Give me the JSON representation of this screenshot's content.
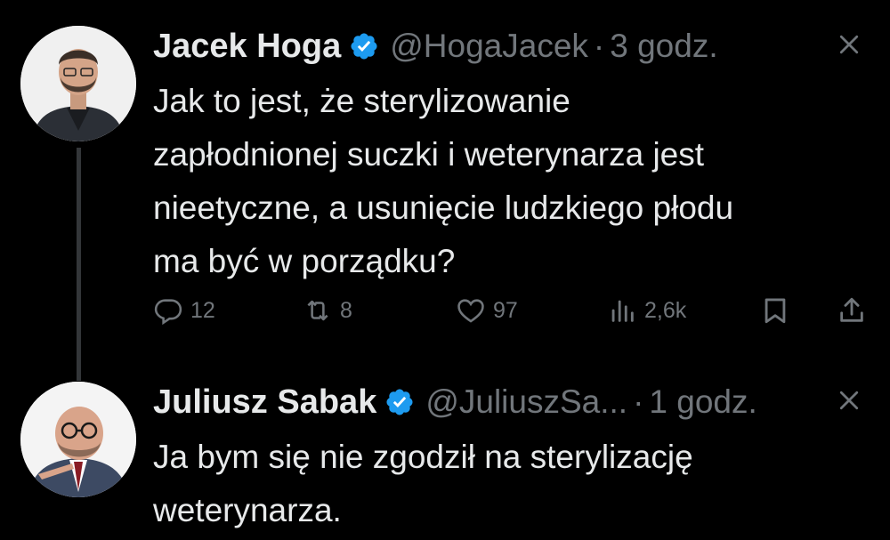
{
  "colors": {
    "background": "#000000",
    "text": "#e7e9ea",
    "secondary": "#71767b",
    "verified": "#1d9bf0",
    "thread_line": "#333639"
  },
  "tweets": [
    {
      "name": "Jacek Hoga",
      "handle": "@HogaJacek",
      "separator": "·",
      "time": "3 godz.",
      "text_lines": [
        "Jak to jest, że sterylizowanie",
        "zapłodnionej suczki i weterynarza jest",
        "nieetyczne, a usunięcie ludzkiego płodu",
        "ma być w porządku?"
      ],
      "actions": {
        "replies": "12",
        "retweets": "8",
        "likes": "97",
        "views": "2,6k"
      },
      "icons": [
        "verified-badge-icon",
        "close-icon",
        "reply-icon",
        "retweet-icon",
        "like-icon",
        "views-icon",
        "bookmark-icon",
        "share-icon"
      ]
    },
    {
      "name": "Juliusz Sabak",
      "handle": "@JuliuszSa...",
      "separator": "·",
      "time": "1 godz.",
      "text_lines": [
        "Ja bym się nie zgodził na sterylizację",
        "weterynarza."
      ],
      "icons": [
        "verified-badge-icon",
        "close-icon"
      ]
    }
  ]
}
